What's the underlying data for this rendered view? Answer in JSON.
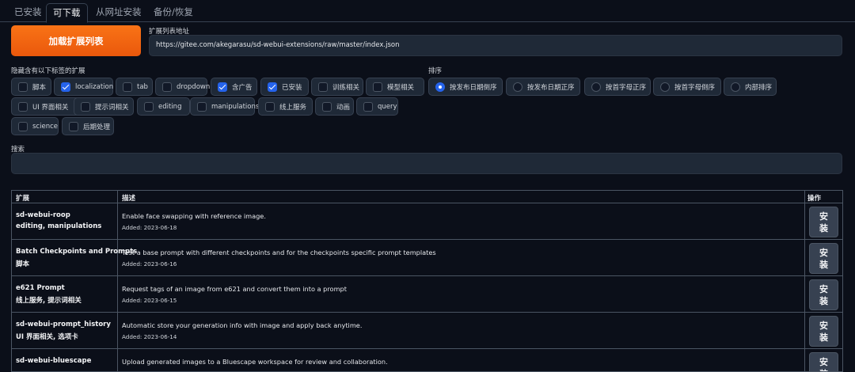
{
  "tabs": [
    "已安装",
    "可下载",
    "从网址安装",
    "备份/恢复"
  ],
  "load_button": "加载扩展列表",
  "url_label": "扩展列表地址",
  "url_value": "https://gitee.com/akegarasu/sd-webui-extensions/raw/master/index.json",
  "hide_label": "隐藏含有以下标签的扩展",
  "hide_tags": [
    {
      "label": "脚本",
      "checked": false
    },
    {
      "label": "localization",
      "checked": true
    },
    {
      "label": "tab",
      "checked": false
    },
    {
      "label": "dropdown",
      "checked": false
    },
    {
      "label": "含广告",
      "checked": true
    },
    {
      "label": "已安装",
      "checked": true
    },
    {
      "label": "训练相关",
      "checked": false
    },
    {
      "label": "模型相关",
      "checked": false
    },
    {
      "label": "UI 界面相关",
      "checked": false
    },
    {
      "label": "提示词相关",
      "checked": false
    },
    {
      "label": "editing",
      "checked": false
    },
    {
      "label": "manipulations",
      "checked": false
    },
    {
      "label": "线上服务",
      "checked": false
    },
    {
      "label": "动画",
      "checked": false
    },
    {
      "label": "query",
      "checked": false
    },
    {
      "label": "science",
      "checked": false
    },
    {
      "label": "后期处理",
      "checked": false
    }
  ],
  "sort_label": "排序",
  "sort_options": [
    {
      "label": "按发布日期倒序",
      "checked": true
    },
    {
      "label": "按发布日期正序",
      "checked": false
    },
    {
      "label": "按首字母正序",
      "checked": false
    },
    {
      "label": "按首字母倒序",
      "checked": false
    },
    {
      "label": "内部排序",
      "checked": false
    }
  ],
  "search_label": "搜索",
  "search_value": "",
  "table": {
    "headers": [
      "扩展",
      "描述",
      "操作"
    ],
    "install_label": "安\n装",
    "rows": [
      {
        "name": "sd-webui-roop",
        "tags": "editing, manipulations",
        "desc": "Enable face swapping with reference image.",
        "added": "Added: 2023-06-18"
      },
      {
        "name": "Batch Checkpoints and Prompts",
        "tags": "脚本",
        "desc": "Test a base prompt with different checkpoints and for the checkpoints specific prompt templates",
        "added": "Added: 2023-06-16"
      },
      {
        "name": "e621 Prompt",
        "tags": "线上服务, 提示词相关",
        "desc": "Request tags of an image from e621 and convert them into a prompt",
        "added": "Added: 2023-06-15"
      },
      {
        "name": "sd-webui-prompt_history",
        "tags": "UI 界面相关, 选项卡",
        "desc": "Automatic store your generation info with image and apply back anytime.",
        "added": "Added: 2023-06-14"
      },
      {
        "name": "sd-webui-bluescape",
        "tags": "",
        "desc": "Upload generated images to a Bluescape workspace for review and collaboration.",
        "added": ""
      }
    ]
  }
}
